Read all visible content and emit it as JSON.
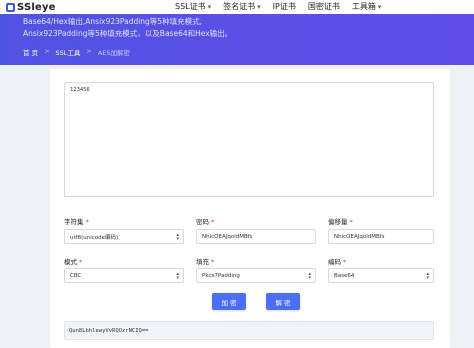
{
  "brand": {
    "name": "SSleye"
  },
  "nav": [
    {
      "label": "SSL证书",
      "dropdown": true
    },
    {
      "label": "签名证书",
      "dropdown": true
    },
    {
      "label": "IP证书",
      "dropdown": false
    },
    {
      "label": "国密证书",
      "dropdown": false
    },
    {
      "label": "工具箱",
      "dropdown": true
    }
  ],
  "hero": {
    "line1": "Base64/Hex输出,Ansix923Padding等5种填充模式,",
    "line2": "Ansix923Padding等5种填充模式，以及Base64和Hex输出。"
  },
  "breadcrumb": {
    "home": "首 页",
    "sep": ">",
    "tools": "SSL工具",
    "current": "AES加解密"
  },
  "input": {
    "value": "123456"
  },
  "fields": {
    "charset": {
      "label": "字符集",
      "value": "utf8(unicode编码)"
    },
    "key": {
      "label": "密码",
      "value": "NhicOEAJqoldMBfs"
    },
    "iv": {
      "label": "偏移量",
      "value": "NhicOEAJqoldMBfs"
    },
    "mode": {
      "label": "模式",
      "value": "CBC"
    },
    "padding": {
      "label": "填充",
      "value": "Pkcs7Padding"
    },
    "encoding": {
      "label": "编码",
      "value": "Base64"
    }
  },
  "buttons": {
    "encrypt": "加 密",
    "decrypt": "解 密"
  },
  "output": {
    "value": "Qun8LbhlewyVvRQOzrNCIQ=="
  }
}
